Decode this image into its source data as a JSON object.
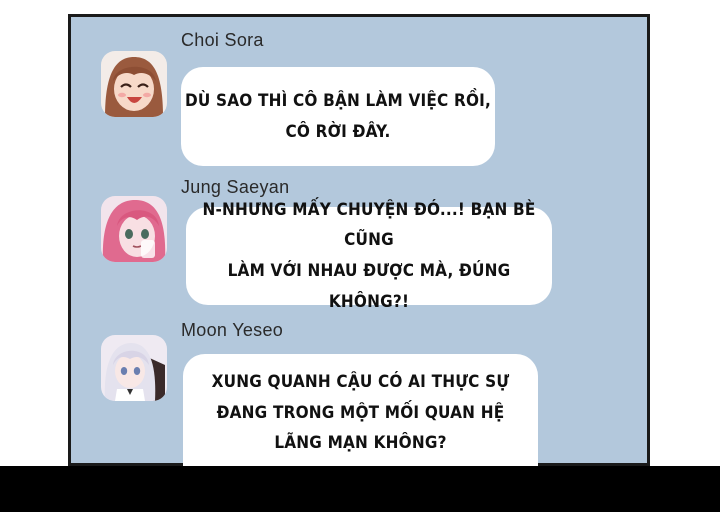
{
  "messages": [
    {
      "sender": "Choi Sora",
      "avatar_icon": "girl-brown-hair-laughing-avatar",
      "text": "DÙ SAO THÌ CÔ BẬN LÀM VIỆC RỒI,\nCÔ RỜI ĐÂY."
    },
    {
      "sender": "Jung Saeyan",
      "avatar_icon": "girl-pink-hair-avatar",
      "text": "N-NHƯNG MẤY CHUYỆN ĐÓ...! BẠN BÈ CŨNG\nLÀM VỚI NHAU ĐƯỢC MÀ, ĐÚNG KHÔNG?!"
    },
    {
      "sender": "Moon Yeseo",
      "avatar_icon": "girl-white-hair-avatar",
      "text": "XUNG QUANH CẬU CÓ AI THỰC SỰ\nĐANG TRONG MỘT MỐI QUAN HỆ\nLÃNG MẠN KHÔNG?"
    }
  ],
  "colors": {
    "panel_background": "#b3c8dc",
    "bubble": "#ffffff",
    "border": "#1a1a1a"
  }
}
